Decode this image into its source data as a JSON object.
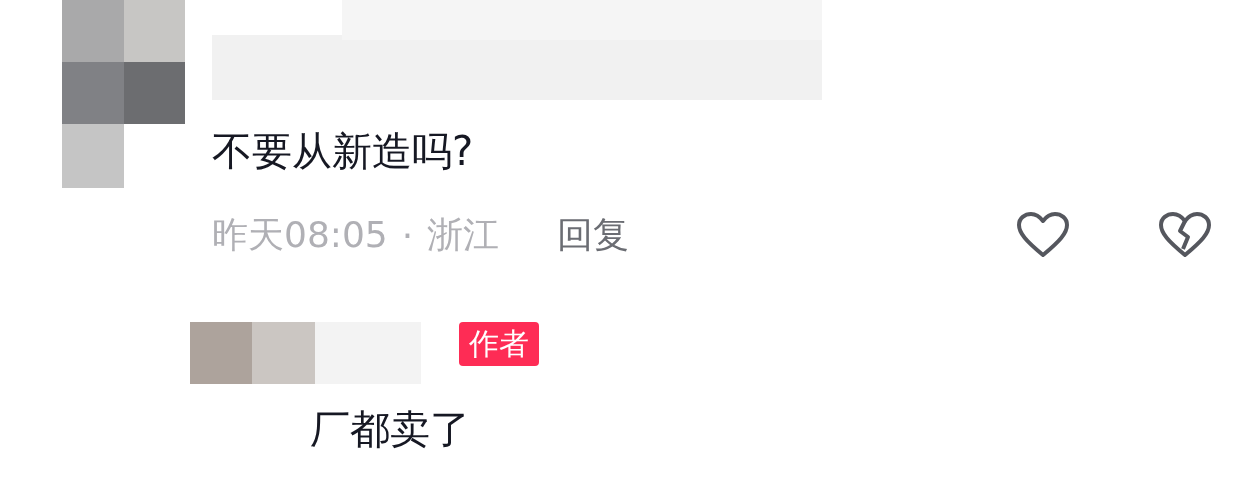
{
  "comment": {
    "text": "不要从新造吗?",
    "time": "昨天08:05",
    "separator": "·",
    "location": "浙江",
    "reply_action": "回复",
    "liked": false,
    "disliked": false
  },
  "reply": {
    "badge": "作者",
    "text": "厂都卖了"
  }
}
